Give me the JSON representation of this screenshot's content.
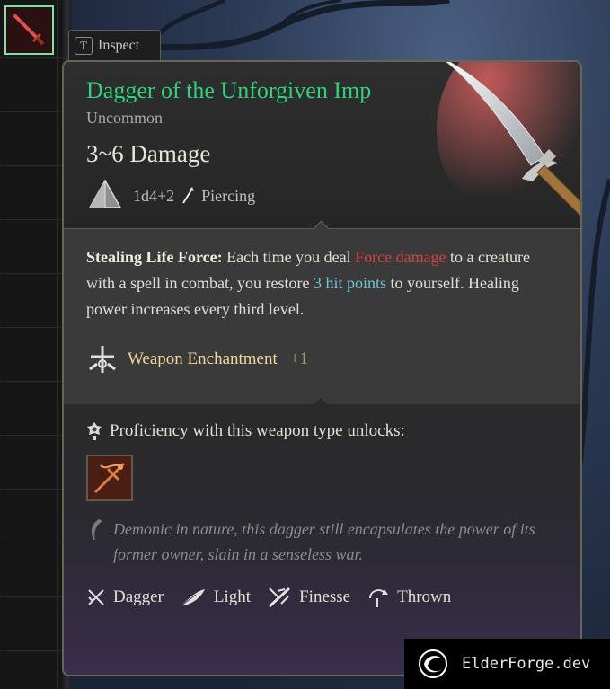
{
  "inspect_tab": {
    "key": "T",
    "label": "Inspect"
  },
  "item": {
    "name": "Dagger of the Unforgiven Imp",
    "rarity": "Uncommon",
    "damage": "3~6 Damage",
    "dice": "1d4+2",
    "damage_type": "Piercing",
    "description": {
      "ability_name": "Stealing Life Force:",
      "text_1": " Each time you deal ",
      "highlight_1": "Force damage",
      "text_2": " to a creature with a spell in combat, you restore ",
      "highlight_2": "3 hit points",
      "text_3": " to yourself. Healing power increases every third level."
    },
    "enchantment": {
      "label": "Weapon Enchantment",
      "value": "+1"
    },
    "proficiency_label": "Proficiency with this weapon type unlocks:",
    "flavor": "Demonic in nature, this dagger still encapsulates the power of its former owner, slain in a senseless war.",
    "properties": [
      {
        "label": "Dagger",
        "icon": "dagger-icon"
      },
      {
        "label": "Light",
        "icon": "feather-icon"
      },
      {
        "label": "Finesse",
        "icon": "finesse-icon"
      },
      {
        "label": "Thrown",
        "icon": "thrown-icon"
      }
    ]
  },
  "colors": {
    "title": "#2fd17a",
    "force_damage": "#d14343",
    "hit_points": "#72c2d6",
    "enchantment": "#efd99a"
  },
  "watermark": "ElderForge.dev"
}
